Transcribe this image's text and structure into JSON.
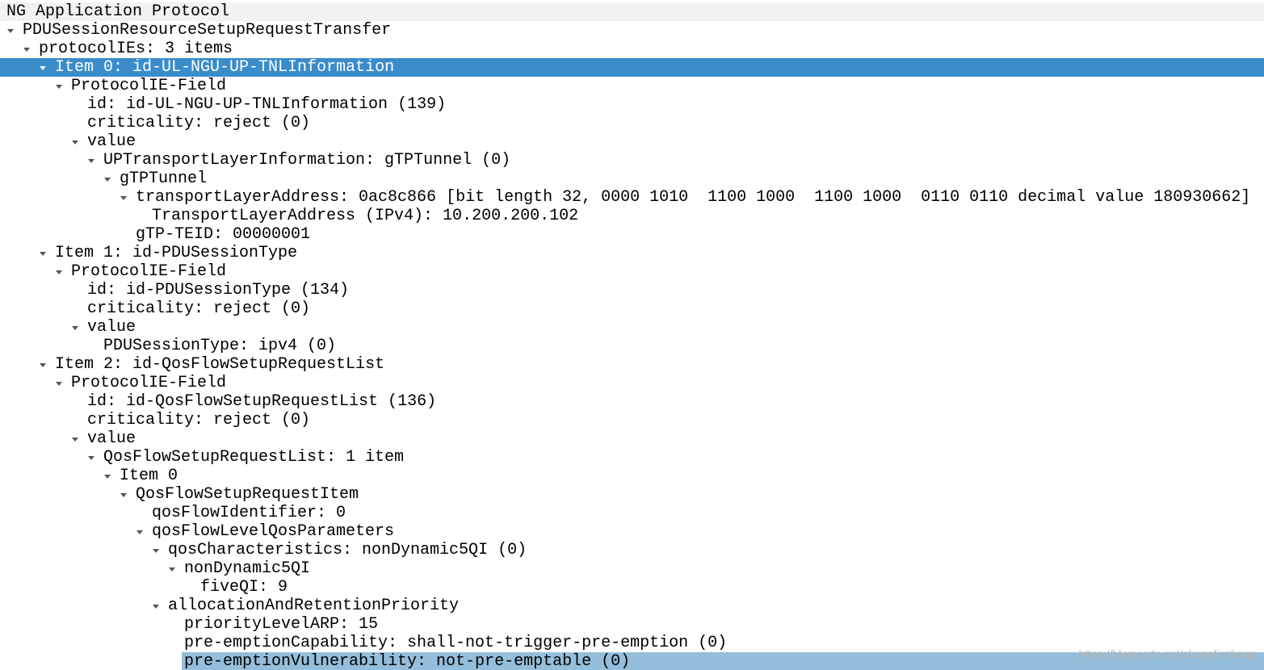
{
  "tree": {
    "rows": [
      {
        "text": "NG Application Protocol",
        "expandable": false,
        "state": "header"
      },
      {
        "text": "PDUSessionResourceSetupRequestTransfer",
        "expandable": true,
        "state": "normal"
      },
      {
        "text": "protocolIEs: 3 items",
        "expandable": true,
        "state": "normal"
      },
      {
        "text": "Item 0: id-UL-NGU-UP-TNLInformation",
        "expandable": true,
        "state": "selected"
      },
      {
        "text": "ProtocolIE-Field",
        "expandable": true,
        "state": "normal"
      },
      {
        "text": "id: id-UL-NGU-UP-TNLInformation (139)",
        "expandable": false,
        "state": "normal"
      },
      {
        "text": "criticality: reject (0)",
        "expandable": false,
        "state": "normal"
      },
      {
        "text": "value",
        "expandable": true,
        "state": "normal"
      },
      {
        "text": "UPTransportLayerInformation: gTPTunnel (0)",
        "expandable": true,
        "state": "normal"
      },
      {
        "text": "gTPTunnel",
        "expandable": true,
        "state": "normal"
      },
      {
        "text": "transportLayerAddress: 0ac8c866 [bit length 32, 0000 1010  1100 1000  1100 1000  0110 0110 decimal value 180930662]",
        "expandable": true,
        "state": "normal"
      },
      {
        "text": "TransportLayerAddress (IPv4): 10.200.200.102",
        "expandable": false,
        "state": "normal"
      },
      {
        "text": "gTP-TEID: 00000001",
        "expandable": false,
        "state": "normal"
      },
      {
        "text": "Item 1: id-PDUSessionType",
        "expandable": true,
        "state": "normal"
      },
      {
        "text": "ProtocolIE-Field",
        "expandable": true,
        "state": "normal"
      },
      {
        "text": "id: id-PDUSessionType (134)",
        "expandable": false,
        "state": "normal"
      },
      {
        "text": "criticality: reject (0)",
        "expandable": false,
        "state": "normal"
      },
      {
        "text": "value",
        "expandable": true,
        "state": "normal"
      },
      {
        "text": "PDUSessionType: ipv4 (0)",
        "expandable": false,
        "state": "normal"
      },
      {
        "text": "Item 2: id-QosFlowSetupRequestList",
        "expandable": true,
        "state": "normal"
      },
      {
        "text": "ProtocolIE-Field",
        "expandable": true,
        "state": "normal"
      },
      {
        "text": "id: id-QosFlowSetupRequestList (136)",
        "expandable": false,
        "state": "normal"
      },
      {
        "text": "criticality: reject (0)",
        "expandable": false,
        "state": "normal"
      },
      {
        "text": "value",
        "expandable": true,
        "state": "normal"
      },
      {
        "text": "QosFlowSetupRequestList: 1 item",
        "expandable": true,
        "state": "normal"
      },
      {
        "text": "Item 0",
        "expandable": true,
        "state": "normal"
      },
      {
        "text": "QosFlowSetupRequestItem",
        "expandable": true,
        "state": "normal"
      },
      {
        "text": "qosFlowIdentifier: 0",
        "expandable": false,
        "state": "normal"
      },
      {
        "text": "qosFlowLevelQosParameters",
        "expandable": true,
        "state": "normal"
      },
      {
        "text": "qosCharacteristics: nonDynamic5QI (0)",
        "expandable": true,
        "state": "normal"
      },
      {
        "text": "nonDynamic5QI",
        "expandable": true,
        "state": "normal"
      },
      {
        "text": "fiveQI: 9",
        "expandable": false,
        "state": "normal"
      },
      {
        "text": "allocationAndRetentionPriority",
        "expandable": true,
        "state": "normal"
      },
      {
        "text": "priorityLevelARP: 15",
        "expandable": false,
        "state": "normal"
      },
      {
        "text": "pre-emptionCapability: shall-not-trigger-pre-emption (0)",
        "expandable": false,
        "state": "normal"
      },
      {
        "text": "pre-emptionVulnerability: not-pre-emptable (0)",
        "expandable": false,
        "state": "related"
      }
    ]
  },
  "watermark": "https://blog.csdn.net/zhonglinzhang",
  "colors": {
    "selected_row": "#3a8ccb",
    "related_row": "#94bedb",
    "header_row": "#f2f2f2"
  }
}
